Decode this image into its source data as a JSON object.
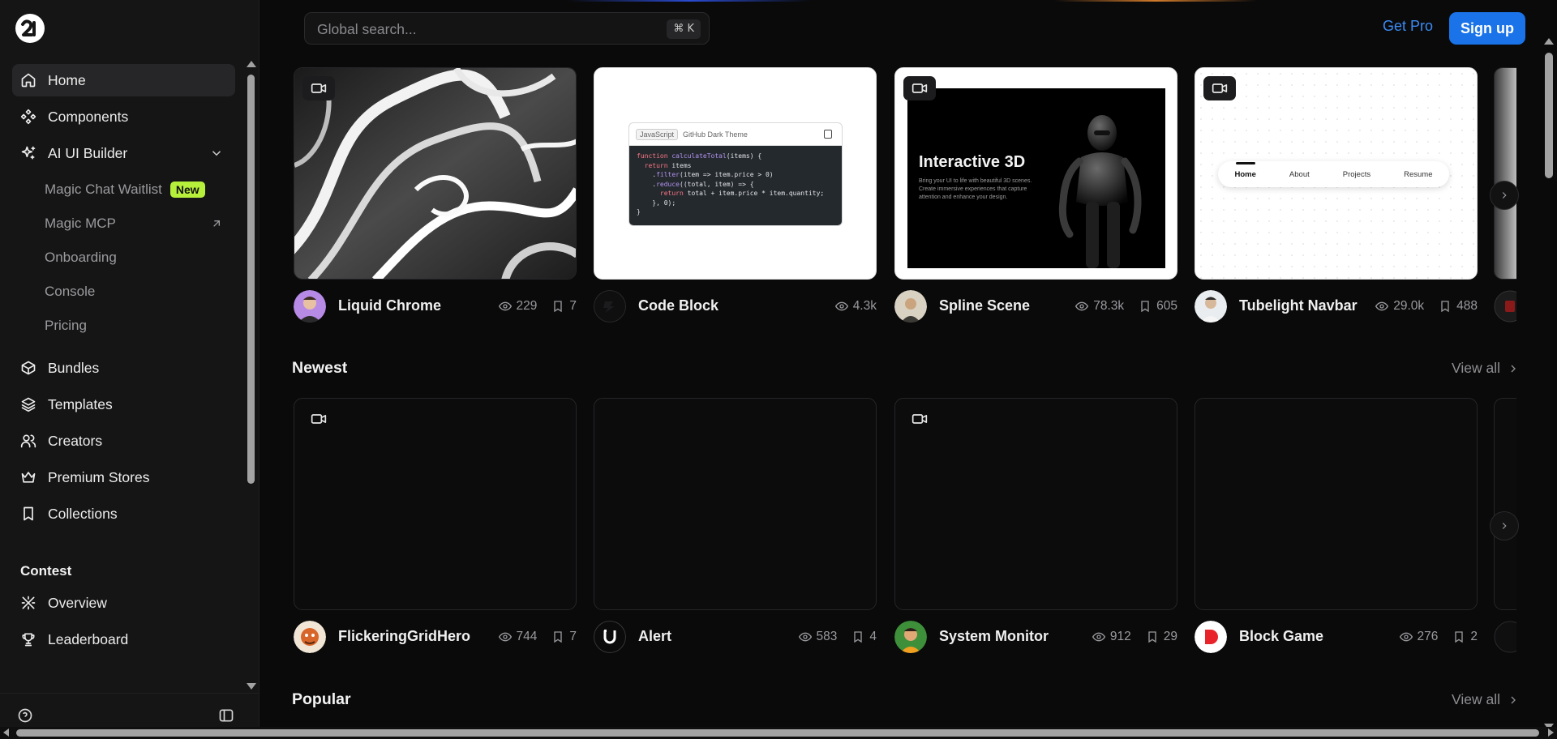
{
  "search": {
    "placeholder": "Global search...",
    "shortcut": "⌘ K"
  },
  "header": {
    "get_pro": "Get Pro",
    "sign_up": "Sign up"
  },
  "sidebar": {
    "items": [
      {
        "label": "Home",
        "icon": "home-icon",
        "active": true
      },
      {
        "label": "Components",
        "icon": "components-icon"
      },
      {
        "label": "AI UI Builder",
        "icon": "sparkles-icon",
        "expanded": true
      }
    ],
    "sub_items": [
      {
        "label": "Magic Chat Waitlist",
        "badge": "New"
      },
      {
        "label": "Magic MCP",
        "icon": "arrow-up-right-icon"
      },
      {
        "label": "Onboarding"
      },
      {
        "label": "Console"
      },
      {
        "label": "Pricing"
      }
    ],
    "items2": [
      {
        "label": "Bundles",
        "icon": "box-icon"
      },
      {
        "label": "Templates",
        "icon": "layers-icon"
      },
      {
        "label": "Creators",
        "icon": "users-icon"
      },
      {
        "label": "Premium Stores",
        "icon": "crown-icon"
      },
      {
        "label": "Collections",
        "icon": "bookmark-icon"
      }
    ],
    "contest_title": "Contest",
    "contest_items": [
      {
        "label": "Overview",
        "icon": "overview-icon"
      },
      {
        "label": "Leaderboard",
        "icon": "trophy-icon"
      }
    ]
  },
  "featured": [
    {
      "name": "Liquid Chrome",
      "views": "229",
      "bookmarks": "7"
    },
    {
      "name": "Code Block",
      "views": "4.3k"
    },
    {
      "name": "Spline Scene",
      "views": "78.3k",
      "bookmarks": "605"
    },
    {
      "name": "Tubelight Navbar",
      "views": "29.0k",
      "bookmarks": "488"
    }
  ],
  "previews": {
    "code": {
      "lang": "JavaScript",
      "theme": "GitHub Dark Theme",
      "lines": [
        "function calculateTotal(items) {",
        "  return items",
        "    .filter(item => item.price > 0)",
        "    .reduce((total, item) => {",
        "      return total + item.price * item.quantity;",
        "    }, 0);",
        "}"
      ]
    },
    "spline": {
      "title": "Interactive 3D",
      "text": "Bring your UI to life with beautiful 3D scenes. Create immersive experiences that capture attention and enhance your design."
    },
    "navbar": {
      "items": [
        "Home",
        "About",
        "Projects",
        "Resume"
      ]
    }
  },
  "sections": {
    "newest": {
      "title": "Newest",
      "view_all": "View all"
    },
    "popular": {
      "title": "Popular",
      "view_all": "View all"
    }
  },
  "newest": [
    {
      "name": "FlickeringGridHero",
      "views": "744",
      "bookmarks": "7"
    },
    {
      "name": "Alert",
      "views": "583",
      "bookmarks": "4"
    },
    {
      "name": "System Monitor",
      "views": "912",
      "bookmarks": "29"
    },
    {
      "name": "Block Game",
      "views": "276",
      "bookmarks": "2"
    }
  ],
  "colors": {
    "accent": "#1a73e8",
    "link": "#3b8bf5",
    "badge": "#b7f03a",
    "background": "#0a0a0b"
  }
}
